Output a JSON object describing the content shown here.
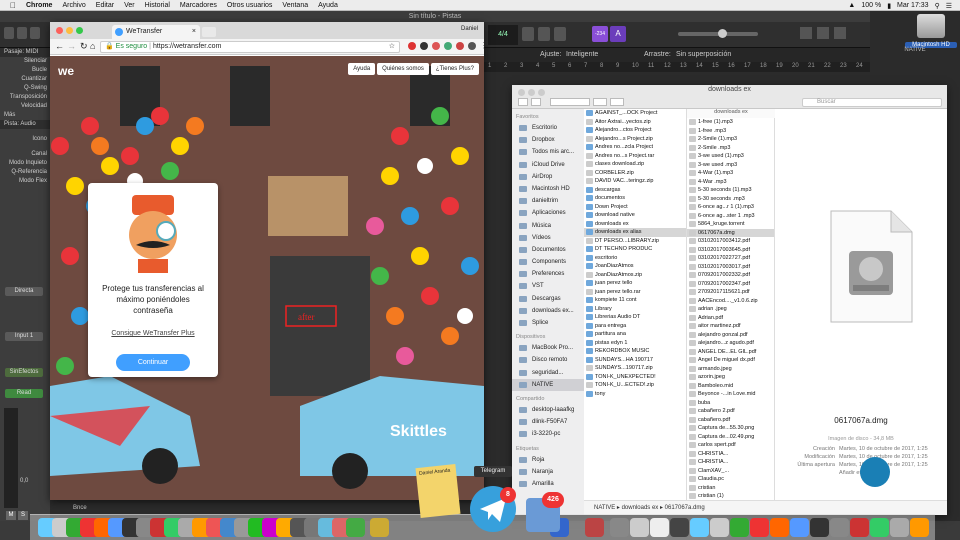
{
  "menubar": {
    "app": "Chrome",
    "items": [
      "Archivo",
      "Editar",
      "Ver",
      "Historial",
      "Marcadores",
      "Otros usuarios",
      "Ventana",
      "Ayuda"
    ],
    "battery": "100 %",
    "clock": "Mar 17:33"
  },
  "logic": {
    "title": "Sin título - Pistas",
    "time_sig": "4/4",
    "lcd": "-234",
    "ajuste_label": "Ajuste:",
    "ajuste_value": "Inteligente",
    "arrastre_label": "Arrastre:",
    "arrastre_value": "Sin superposición",
    "ruler": [
      "1",
      "2",
      "3",
      "4",
      "5",
      "6",
      "7",
      "8",
      "9",
      "10",
      "11",
      "12",
      "13",
      "14",
      "15",
      "16",
      "17",
      "18",
      "19",
      "20",
      "21",
      "22",
      "23",
      "24"
    ],
    "inspector": {
      "pasaje": "Pasaje: MIDI",
      "rows": [
        "Silenciar",
        "Bucle",
        "Cuantizar",
        "Q-Swing",
        "Transposición",
        "Velocidad"
      ],
      "mas": "Más",
      "pista": "Pista: Audio",
      "rows2": [
        "Icono",
        "Canal",
        "Modo Inquieto",
        "Q-Referencia",
        "Modo Flex"
      ],
      "directa": "Directa",
      "inout": "Input 1",
      "sin_efectos": "SinEfectos",
      "read": "Read",
      "bnce": "Bnce",
      "m": "M",
      "s": "S"
    },
    "eq_value": "0,0",
    "desktop_disk": "Macintosh HD",
    "native_label": "NATIVE"
  },
  "chrome": {
    "tab_title": "WeTransfer",
    "profile": "Daniel",
    "secure": "Es seguro",
    "url": "https://wetransfer.com",
    "nav": [
      "Ayuda",
      "Quiénes somos",
      "¿Tienes Plus?"
    ],
    "logo": "we",
    "card_text": "Protege tus transferencias al máximo poniéndoles contraseña",
    "card_link": "Consigue WeTransfer Plus",
    "card_button": "Continuar",
    "shop_sign": "after",
    "car_text": "Skittles"
  },
  "finder": {
    "title": "downloads ex",
    "search_placeholder": "Buscar",
    "sidebar_favorites_header": "Favoritos",
    "sidebar_favorites": [
      "Escritorio",
      "Dropbox",
      "Todos mis arc...",
      "iCloud Drive",
      "AirDrop",
      "Macintosh HD",
      "danieltrim",
      "Aplicaciones",
      "Música",
      "Vídeos",
      "Documentos",
      "Components",
      "Preferences",
      "VST",
      "Descargas",
      "downloads ex...",
      "Splice"
    ],
    "sidebar_devices_header": "Dispositivos",
    "sidebar_devices": [
      "MacBook Pro...",
      "Disco remoto",
      "seguridad...",
      "NATIVE"
    ],
    "sidebar_shared_header": "Compartido",
    "sidebar_shared": [
      "desktop-laaafkg",
      "dlink-F50FA7",
      "i3-3220-pc"
    ],
    "sidebar_tags_header": "Etiquetas",
    "sidebar_tags": [
      "Roja",
      "Naranja",
      "Amarilla"
    ],
    "col1": [
      "AGAINST_...OCK Project",
      "Aitor Axtrai...yectos.zip",
      "Alejandro...ctos Project",
      "Alejandro...s Project.zip",
      "Andres no...zcla Project",
      "Andres no...s Project.rar",
      "clases download.zip",
      "CORBELER.zip",
      "DAVID VAC...teringz.zip",
      "descargas",
      "documentos",
      "Down Project",
      "download native",
      "downloads ex",
      "downloads ex alias",
      "DT PERSO...LIBRARY.zip",
      "DT TECHNO PRODUC",
      "escritorio",
      "JoanDiazAtmos",
      "JoanDiazAtmos.zip",
      "juan perez tello",
      "juan perez tello.rar",
      "kompiete 11 cont",
      "Library",
      "Librerias Audio DT",
      "para entrega",
      "partitura ana",
      "pistas edyn 1",
      "REKORDBOX MUSIC",
      "SUNDAYS...HA 190717",
      "SUNDAYS...190717.zip",
      "TONI-K_UNEXPECTED!",
      "TONI-K_U...ECTED!.zip",
      "tony"
    ],
    "col1_folders": [
      0,
      2,
      4,
      9,
      10,
      11,
      12,
      13,
      14,
      16,
      17,
      18,
      20,
      22,
      23,
      24,
      25,
      26,
      27,
      28,
      29,
      31,
      33
    ],
    "col1_selected": 14,
    "col2_header": "downloads ex",
    "col2": [
      "1-free (1).mp3",
      "1-free .mp3",
      "2-Smile (1).mp3",
      "2-Smile .mp3",
      "3-we used (1).mp3",
      "3-we used .mp3",
      "4-War (1).mp3",
      "4-War .mp3",
      "5-30 seconds (1).mp3",
      "5-30 seconds .mp3",
      "6-once ag...r 1 (1).mp3",
      "6-once ag...ster 1 .mp3",
      "5864_kruge.torrent",
      "0617067a.dmg",
      "03102017003412.pdf",
      "03102017003645.pdf",
      "03102017022727.pdf",
      "03102017003017.pdf",
      "07092017002332.pdf",
      "07092017002347.pdf",
      "27092017115621.pdf",
      "AACEncod...._v1.0.6.zip",
      "adrian .jpeg",
      "Adrian.pdf",
      "aitor martinez.pdf",
      "alejandro gonzal.pdf",
      "alejandro...z agudo.pdf",
      "ANGEL DE...EL GIL.pdf",
      "Angel De miguel dx.pdf",
      "armando.jpeg",
      "azorin.jpeg",
      "Bamboleo.mid",
      "Beyonce -...in Love.mid",
      "buba",
      "cabañero 2.pdf",
      "cabañero.pdf",
      "Captura de...55.30.png",
      "Captura de...02.49.png",
      "carlos spert.pdf",
      "CHRISTIA...",
      "CHRISTIA...",
      "ClamXAV_...",
      "Claudia.pc",
      "cristian",
      "cristian (1)"
    ],
    "col2_selected": 13,
    "preview_name": "0617067a.dmg",
    "preview_kind": "Imagen de disco - 34,8 MB",
    "preview_created_label": "Creación",
    "preview_created": "Martes, 10 de octubre de 2017, 1:25",
    "preview_modified_label": "Modificación",
    "preview_modified": "Martes, 10 de octubre de 2017, 1:25",
    "preview_opened_label": "Última apertura",
    "preview_opened": "Martes, 10 de octubre de 2017, 1:25",
    "preview_tags": "Añadir etiquetas...",
    "path": [
      "NATIVE",
      "downloads ex",
      "0617067a.dmg"
    ]
  },
  "dock": {
    "telegram_tooltip": "Telegram",
    "telegram_badge": "8",
    "mail_badge": "426",
    "stickies_label": "Daniel Aranda"
  },
  "colors": {
    "accent": "#409fff",
    "wetransfer_btn": "#409fff",
    "badge": "#e33333",
    "logic_bg": "#2b2b2b",
    "lcd_purple": "#8a4fd8"
  }
}
